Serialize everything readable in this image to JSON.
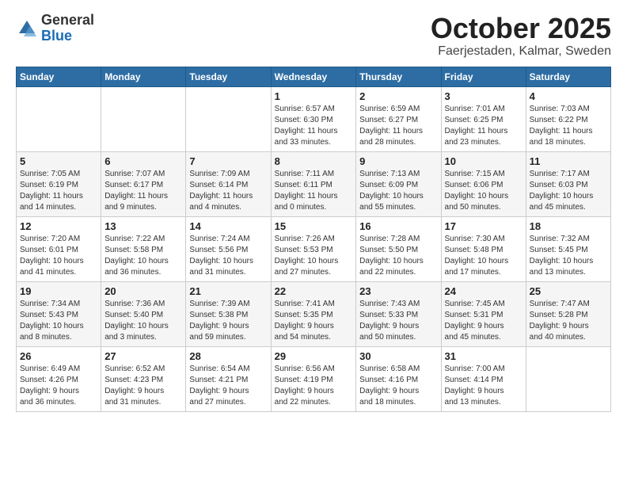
{
  "logo": {
    "general": "General",
    "blue": "Blue"
  },
  "header": {
    "month": "October 2025",
    "location": "Faerjestaden, Kalmar, Sweden"
  },
  "weekdays": [
    "Sunday",
    "Monday",
    "Tuesday",
    "Wednesday",
    "Thursday",
    "Friday",
    "Saturday"
  ],
  "weeks": [
    [
      {
        "day": "",
        "info": ""
      },
      {
        "day": "",
        "info": ""
      },
      {
        "day": "",
        "info": ""
      },
      {
        "day": "1",
        "info": "Sunrise: 6:57 AM\nSunset: 6:30 PM\nDaylight: 11 hours\nand 33 minutes."
      },
      {
        "day": "2",
        "info": "Sunrise: 6:59 AM\nSunset: 6:27 PM\nDaylight: 11 hours\nand 28 minutes."
      },
      {
        "day": "3",
        "info": "Sunrise: 7:01 AM\nSunset: 6:25 PM\nDaylight: 11 hours\nand 23 minutes."
      },
      {
        "day": "4",
        "info": "Sunrise: 7:03 AM\nSunset: 6:22 PM\nDaylight: 11 hours\nand 18 minutes."
      }
    ],
    [
      {
        "day": "5",
        "info": "Sunrise: 7:05 AM\nSunset: 6:19 PM\nDaylight: 11 hours\nand 14 minutes."
      },
      {
        "day": "6",
        "info": "Sunrise: 7:07 AM\nSunset: 6:17 PM\nDaylight: 11 hours\nand 9 minutes."
      },
      {
        "day": "7",
        "info": "Sunrise: 7:09 AM\nSunset: 6:14 PM\nDaylight: 11 hours\nand 4 minutes."
      },
      {
        "day": "8",
        "info": "Sunrise: 7:11 AM\nSunset: 6:11 PM\nDaylight: 11 hours\nand 0 minutes."
      },
      {
        "day": "9",
        "info": "Sunrise: 7:13 AM\nSunset: 6:09 PM\nDaylight: 10 hours\nand 55 minutes."
      },
      {
        "day": "10",
        "info": "Sunrise: 7:15 AM\nSunset: 6:06 PM\nDaylight: 10 hours\nand 50 minutes."
      },
      {
        "day": "11",
        "info": "Sunrise: 7:17 AM\nSunset: 6:03 PM\nDaylight: 10 hours\nand 45 minutes."
      }
    ],
    [
      {
        "day": "12",
        "info": "Sunrise: 7:20 AM\nSunset: 6:01 PM\nDaylight: 10 hours\nand 41 minutes."
      },
      {
        "day": "13",
        "info": "Sunrise: 7:22 AM\nSunset: 5:58 PM\nDaylight: 10 hours\nand 36 minutes."
      },
      {
        "day": "14",
        "info": "Sunrise: 7:24 AM\nSunset: 5:56 PM\nDaylight: 10 hours\nand 31 minutes."
      },
      {
        "day": "15",
        "info": "Sunrise: 7:26 AM\nSunset: 5:53 PM\nDaylight: 10 hours\nand 27 minutes."
      },
      {
        "day": "16",
        "info": "Sunrise: 7:28 AM\nSunset: 5:50 PM\nDaylight: 10 hours\nand 22 minutes."
      },
      {
        "day": "17",
        "info": "Sunrise: 7:30 AM\nSunset: 5:48 PM\nDaylight: 10 hours\nand 17 minutes."
      },
      {
        "day": "18",
        "info": "Sunrise: 7:32 AM\nSunset: 5:45 PM\nDaylight: 10 hours\nand 13 minutes."
      }
    ],
    [
      {
        "day": "19",
        "info": "Sunrise: 7:34 AM\nSunset: 5:43 PM\nDaylight: 10 hours\nand 8 minutes."
      },
      {
        "day": "20",
        "info": "Sunrise: 7:36 AM\nSunset: 5:40 PM\nDaylight: 10 hours\nand 3 minutes."
      },
      {
        "day": "21",
        "info": "Sunrise: 7:39 AM\nSunset: 5:38 PM\nDaylight: 9 hours\nand 59 minutes."
      },
      {
        "day": "22",
        "info": "Sunrise: 7:41 AM\nSunset: 5:35 PM\nDaylight: 9 hours\nand 54 minutes."
      },
      {
        "day": "23",
        "info": "Sunrise: 7:43 AM\nSunset: 5:33 PM\nDaylight: 9 hours\nand 50 minutes."
      },
      {
        "day": "24",
        "info": "Sunrise: 7:45 AM\nSunset: 5:31 PM\nDaylight: 9 hours\nand 45 minutes."
      },
      {
        "day": "25",
        "info": "Sunrise: 7:47 AM\nSunset: 5:28 PM\nDaylight: 9 hours\nand 40 minutes."
      }
    ],
    [
      {
        "day": "26",
        "info": "Sunrise: 6:49 AM\nSunset: 4:26 PM\nDaylight: 9 hours\nand 36 minutes."
      },
      {
        "day": "27",
        "info": "Sunrise: 6:52 AM\nSunset: 4:23 PM\nDaylight: 9 hours\nand 31 minutes."
      },
      {
        "day": "28",
        "info": "Sunrise: 6:54 AM\nSunset: 4:21 PM\nDaylight: 9 hours\nand 27 minutes."
      },
      {
        "day": "29",
        "info": "Sunrise: 6:56 AM\nSunset: 4:19 PM\nDaylight: 9 hours\nand 22 minutes."
      },
      {
        "day": "30",
        "info": "Sunrise: 6:58 AM\nSunset: 4:16 PM\nDaylight: 9 hours\nand 18 minutes."
      },
      {
        "day": "31",
        "info": "Sunrise: 7:00 AM\nSunset: 4:14 PM\nDaylight: 9 hours\nand 13 minutes."
      },
      {
        "day": "",
        "info": ""
      }
    ]
  ]
}
